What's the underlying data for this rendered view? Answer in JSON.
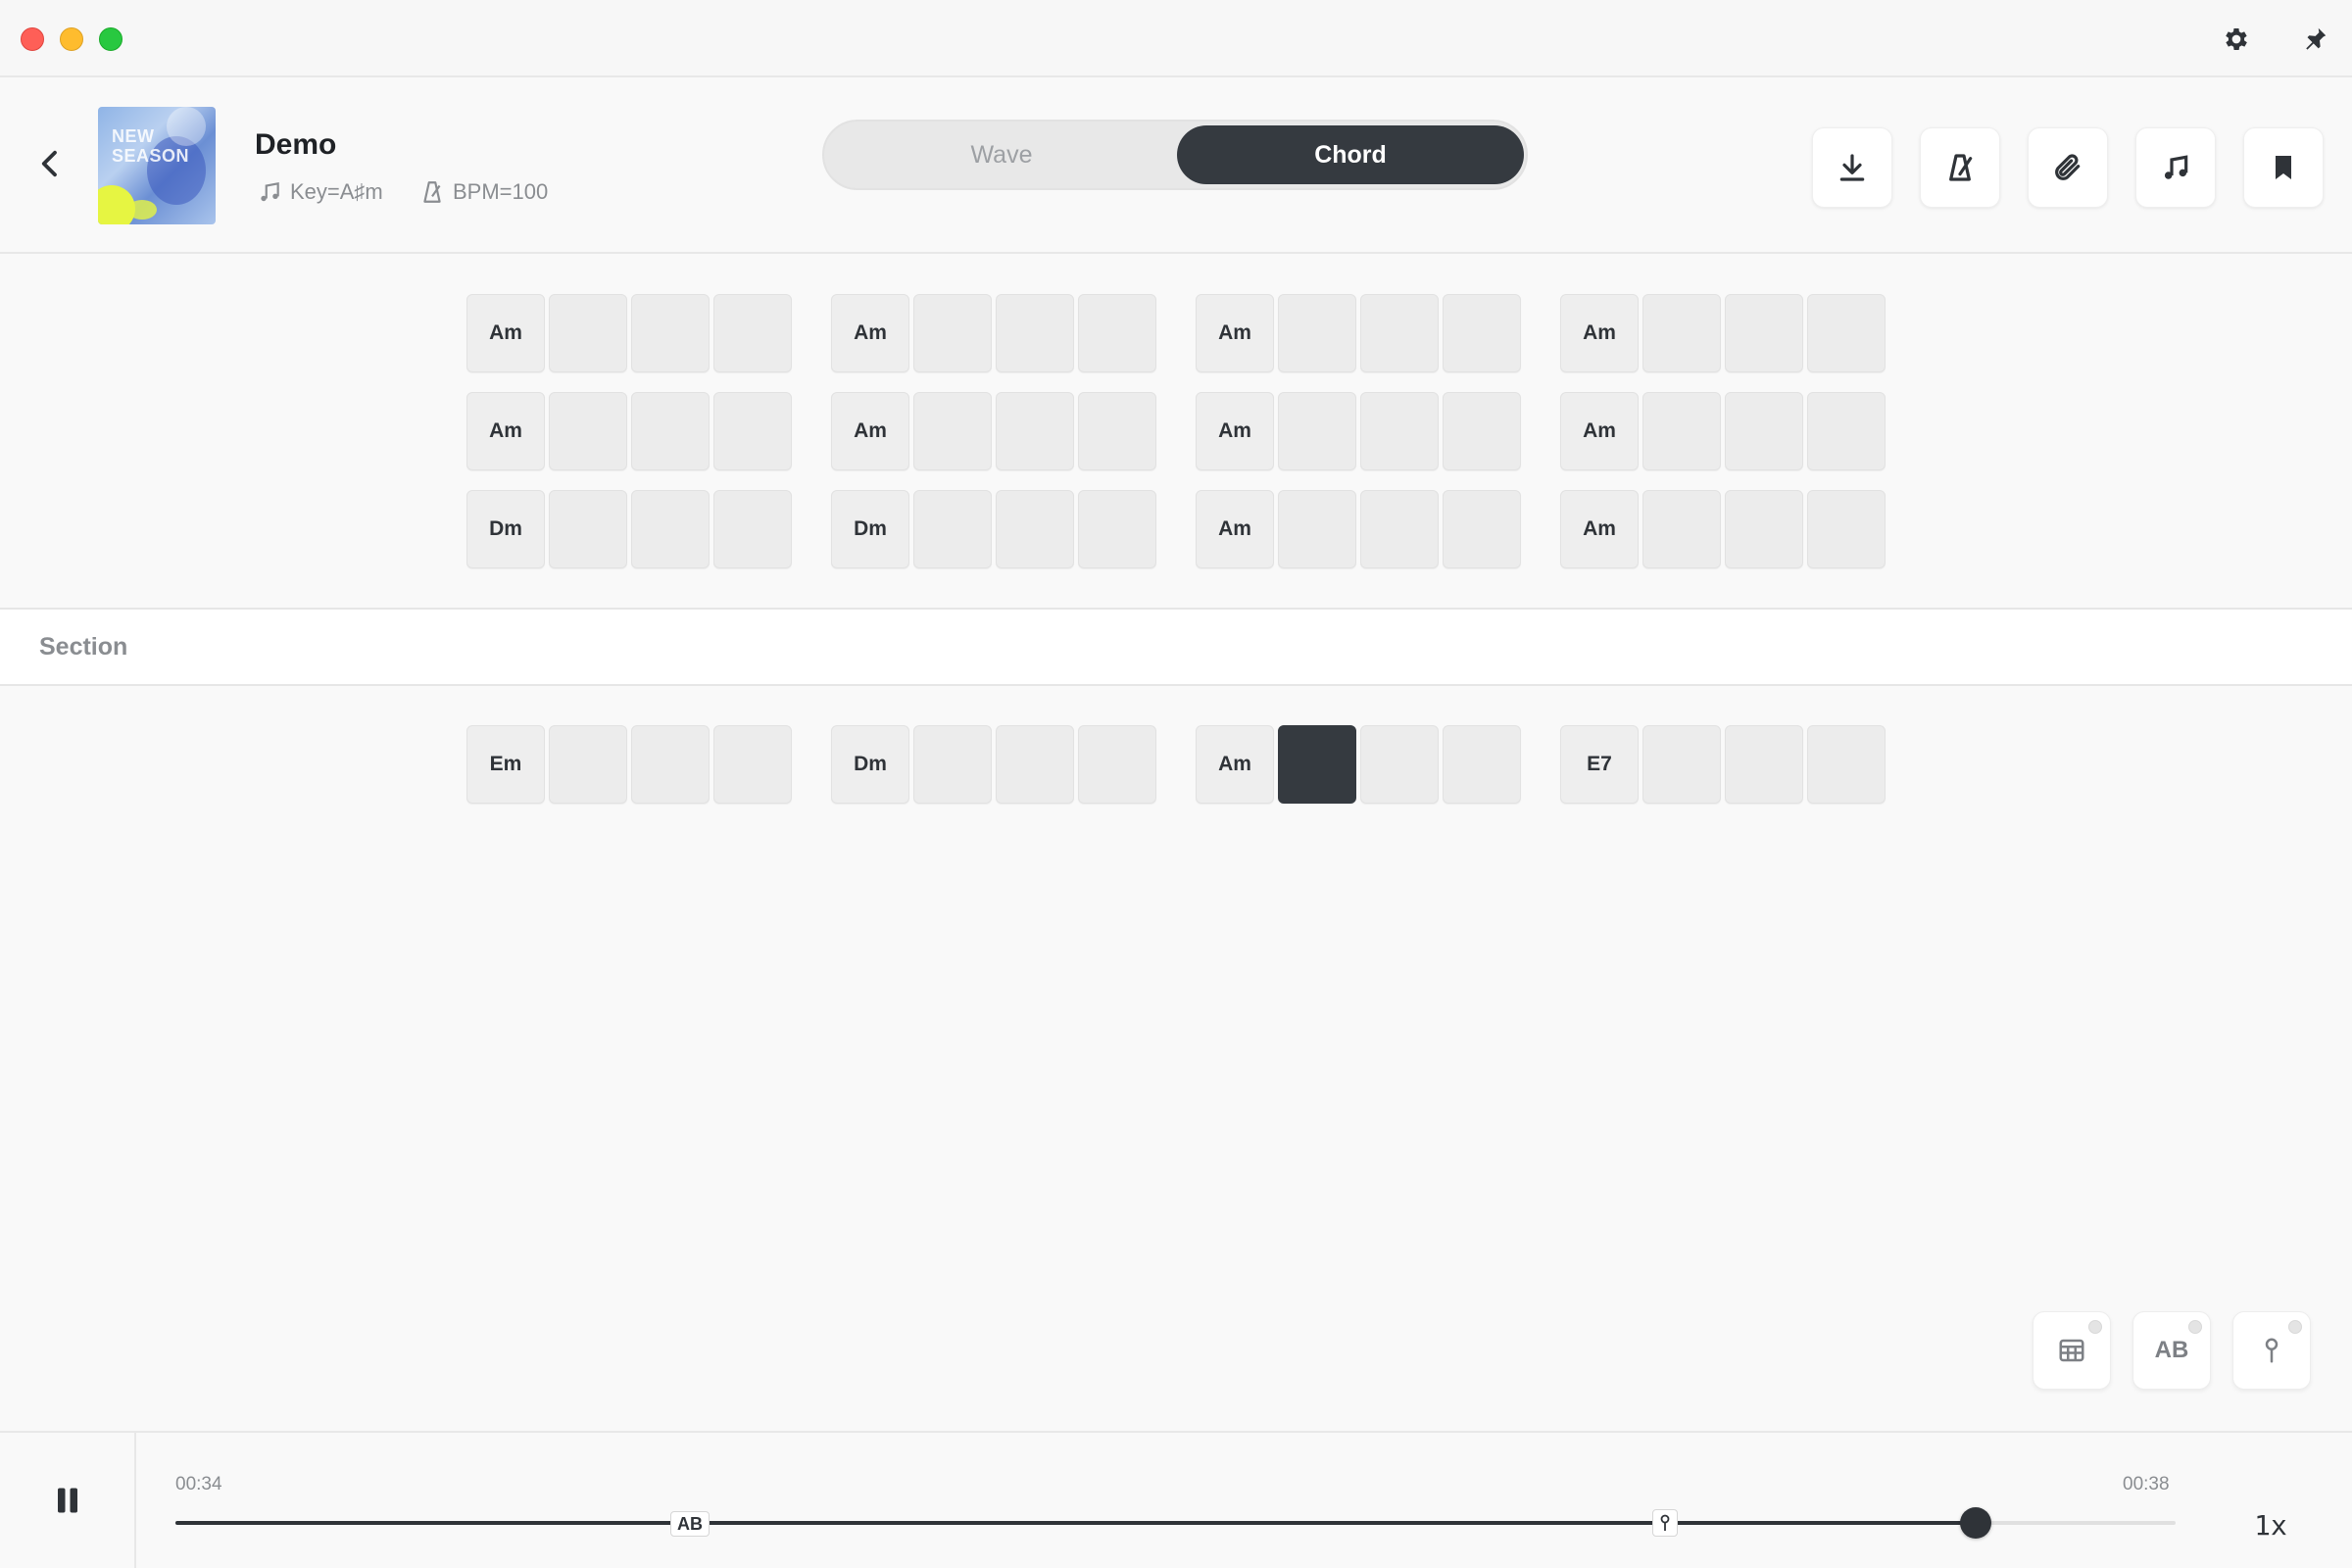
{
  "window": {
    "icons": [
      "gear-icon",
      "pin-icon"
    ]
  },
  "header": {
    "title": "Demo",
    "key": "Key=A♯m",
    "bpm": "BPM=100",
    "cover_text": [
      "NEW",
      "SEASON"
    ],
    "tabs": [
      {
        "label": "Wave",
        "active": false
      },
      {
        "label": "Chord",
        "active": true
      }
    ],
    "actions": [
      "download-icon",
      "metronome-icon",
      "paperclip-icon",
      "music-note-icon",
      "bookmark-icon"
    ]
  },
  "grid": {
    "rows": [
      [
        "Am",
        "Am",
        "Am",
        "Am"
      ],
      [
        "Am",
        "Am",
        "Am",
        "Am"
      ],
      [
        "Dm",
        "Dm",
        "Am",
        "Am"
      ]
    ]
  },
  "section": {
    "label": "Section",
    "rows": [
      [
        "Em",
        "Dm",
        "Am",
        "E7"
      ]
    ],
    "active_bar": 2,
    "active_beat": 1
  },
  "tools": {
    "ab_label": "AB",
    "items": [
      "grid-icon",
      "ab-loop",
      "pin-icon"
    ]
  },
  "player": {
    "current_time": "00:34",
    "total_time": "00:38",
    "speed": "1x",
    "ab_marker": "AB",
    "progress": 0.9
  },
  "colors": {
    "accent": "#353a40",
    "background": "#f9f9f9",
    "cell": "#ececec"
  }
}
